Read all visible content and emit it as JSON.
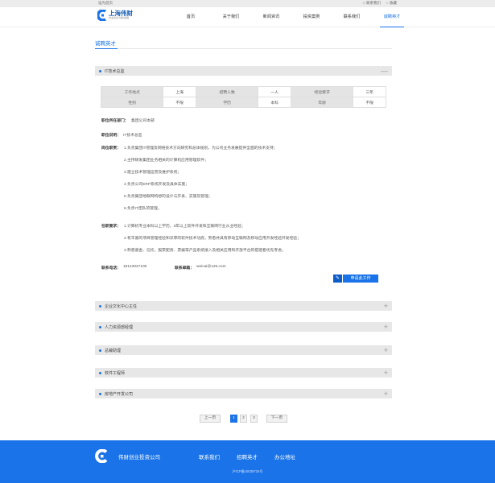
{
  "topbar": {
    "home_link": "设为首页",
    "items": [
      "联系我们",
      "收藏"
    ]
  },
  "brand": {
    "name": "上海伟财",
    "sub": "创业投资·创新发展"
  },
  "nav": [
    "首页",
    "关于我们",
    "新闻资讯",
    "投资案例",
    "联系我们",
    "诚聘英才"
  ],
  "page_title": "诚聘英才",
  "job": {
    "title": "IT技术总监",
    "collapse_icon": "—",
    "table": [
      [
        "工作地点",
        "上海",
        "招聘人数",
        "一人",
        "经验要求",
        "三年"
      ],
      [
        "性别",
        "不限",
        "学历",
        "本科",
        "年龄",
        "不限"
      ]
    ],
    "dept_label": "职位所在部门：",
    "dept": "集团公司本部",
    "desc_label": "职位说明：",
    "desc": "IT技术总监",
    "duty_label": "岗位职责：",
    "duties": [
      "1.负责集团IT管理及网络技术方向研究和总体规划，为公司业务发展提供全面的技术支持；",
      "2.主持研发集团业务相关的计算机应用管理软件；",
      "3.建立技术管理运营及维护系统；",
      "4.负责公司ERP系统开发及具体实施；",
      "5.负责集团地联网构想的设计与开发、实施及管理；",
      "6.负责IT团队的管理。"
    ],
    "req_label": "任职要求：",
    "reqs": [
      "1.计算机专业本科以上学历，3年以上软件开发和互联网行业从业经验；",
      "2.有丰富的项目管理经验和深厚的软件技术功底，熟悉并具有移动互联网及移动应用开发经验开发经验；",
      "3.熟悉基金、信托、股票配资、票据等产品系统接入及相关应用和开放平台的搭建者优先考虑。"
    ],
    "phone_label": "联系电话：",
    "phone": "18143027100",
    "email_label": "联系邮箱：",
    "email": "weicai@126.com",
    "apply_label": "申请此工作",
    "apply_icon": "pencil-icon"
  },
  "other_jobs": [
    "企业文化中心主任",
    "人力资源部经理",
    "总裁助理",
    "软件工程师",
    "房地产开发公司"
  ],
  "expand_icon": "+",
  "pagination": {
    "prev": "上一页",
    "pages": [
      "1",
      "2",
      "3"
    ],
    "current": "1",
    "next": "下一页"
  },
  "footer": {
    "company": "伟财创业投资公司",
    "links": [
      "联系我们",
      "招聘英才",
      "办公地址"
    ],
    "icp": "沪ICP备15035734号"
  },
  "colors": {
    "accent": "#1a73e8",
    "footer": "#1a73e8"
  }
}
